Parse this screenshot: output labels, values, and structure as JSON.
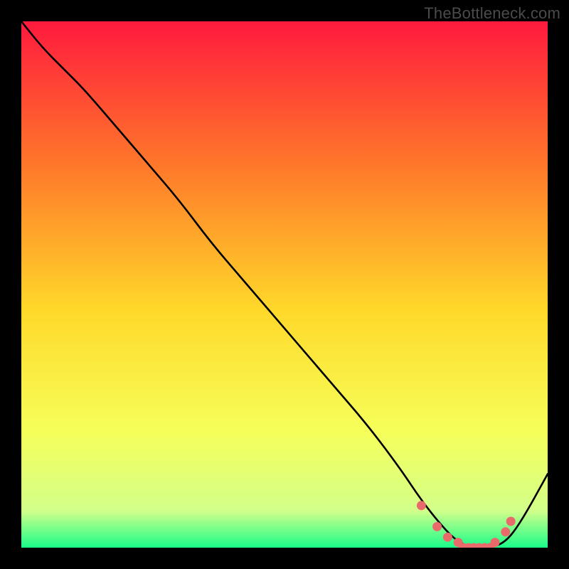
{
  "watermark": "TheBottleneck.com",
  "colors": {
    "bg": "#000000",
    "curve": "#000000",
    "marker": "#e96a6a",
    "gradient_top": "#ff1a3e",
    "gradient_upper_mid": "#ff7a2a",
    "gradient_mid": "#ffd92a",
    "gradient_lower_mid": "#f6ff5a",
    "gradient_near_bottom": "#d2ff8a",
    "gradient_bottom": "#1afc8a"
  },
  "chart_data": {
    "type": "line",
    "xlabel": "",
    "ylabel": "",
    "xlim": [
      0,
      100
    ],
    "ylim": [
      0,
      100
    ],
    "title": "",
    "series": [
      {
        "name": "bottleneck-curve",
        "x": [
          0,
          4,
          8,
          12,
          18,
          24,
          30,
          36,
          42,
          48,
          54,
          60,
          66,
          72,
          76,
          80,
          83,
          86,
          89,
          92,
          95,
          100
        ],
        "y": [
          100,
          95,
          91,
          87,
          80,
          73,
          66,
          58,
          51,
          44,
          37,
          30,
          23,
          15,
          9,
          4,
          1,
          0,
          0,
          1,
          5,
          14
        ]
      }
    ],
    "markers": {
      "name": "highlight-dots",
      "x": [
        76,
        79,
        81,
        83,
        84,
        85,
        86,
        87,
        88,
        89,
        90,
        92,
        93
      ],
      "y": [
        8,
        4,
        2,
        1,
        0,
        0,
        0,
        0,
        0,
        0,
        1,
        3,
        5
      ]
    }
  }
}
